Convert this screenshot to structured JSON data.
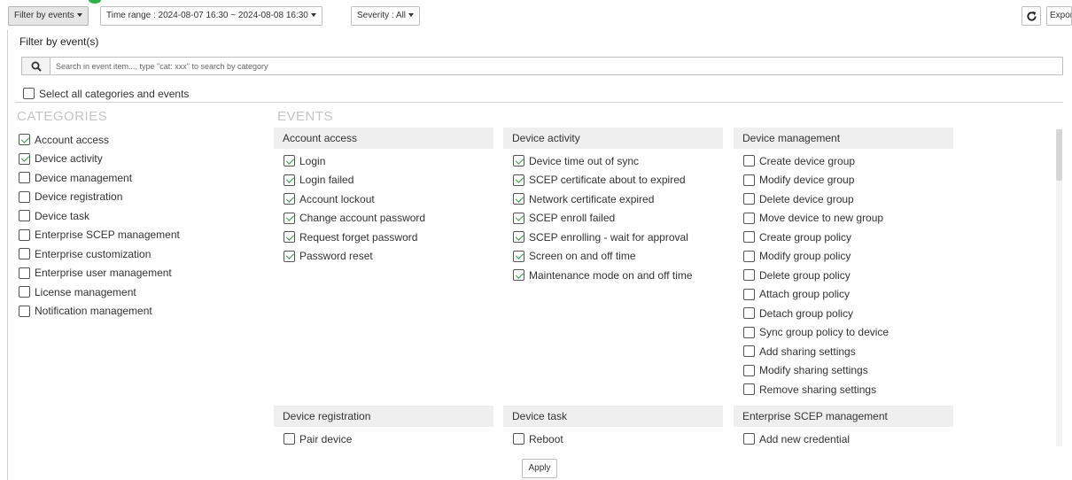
{
  "toolbar": {
    "filter_label": "Filter by events",
    "time_range_label": "Time range : 2024-08-07 16:30 ~ 2024-08-08 16:30",
    "severity_label": "Severity : All",
    "refresh_icon": "refresh-icon",
    "export_label": "Export"
  },
  "panel": {
    "title": "Filter by event(s)",
    "search_placeholder": "Search in event item..., type \"cat: xxx\" to search by category",
    "search_icon": "search-icon",
    "select_all_label": "Select all categories and events",
    "categories_heading": "CATEGORIES",
    "events_heading": "EVENTS"
  },
  "categories": [
    {
      "label": "Account access",
      "checked": true
    },
    {
      "label": "Device activity",
      "checked": true
    },
    {
      "label": "Device management",
      "checked": false
    },
    {
      "label": "Device registration",
      "checked": false
    },
    {
      "label": "Device task",
      "checked": false
    },
    {
      "label": "Enterprise SCEP management",
      "checked": false
    },
    {
      "label": "Enterprise customization",
      "checked": false
    },
    {
      "label": "Enterprise user management",
      "checked": false
    },
    {
      "label": "License management",
      "checked": false
    },
    {
      "label": "Notification management",
      "checked": false
    }
  ],
  "event_groups": [
    {
      "title": "Account access",
      "events": [
        {
          "label": "Login",
          "checked": true
        },
        {
          "label": "Login failed",
          "checked": true
        },
        {
          "label": "Account lockout",
          "checked": true
        },
        {
          "label": "Change account password",
          "checked": true
        },
        {
          "label": "Request forget password",
          "checked": true
        },
        {
          "label": "Password reset",
          "checked": true
        }
      ]
    },
    {
      "title": "Device activity",
      "events": [
        {
          "label": "Device time out of sync",
          "checked": true
        },
        {
          "label": "SCEP certificate about to expired",
          "checked": true
        },
        {
          "label": "Network certificate expired",
          "checked": true
        },
        {
          "label": "SCEP enroll failed",
          "checked": true
        },
        {
          "label": "SCEP enrolling - wait for approval",
          "checked": true
        },
        {
          "label": "Screen on and off time",
          "checked": true
        },
        {
          "label": "Maintenance mode on and off time",
          "checked": true
        }
      ]
    },
    {
      "title": "Device management",
      "events": [
        {
          "label": "Create device group",
          "checked": false
        },
        {
          "label": "Modify device group",
          "checked": false
        },
        {
          "label": "Delete device group",
          "checked": false
        },
        {
          "label": "Move device to new group",
          "checked": false
        },
        {
          "label": "Create group policy",
          "checked": false
        },
        {
          "label": "Modify group policy",
          "checked": false
        },
        {
          "label": "Delete group policy",
          "checked": false
        },
        {
          "label": "Attach group policy",
          "checked": false
        },
        {
          "label": "Detach group policy",
          "checked": false
        },
        {
          "label": "Sync group policy to device",
          "checked": false
        },
        {
          "label": "Add sharing settings",
          "checked": false
        },
        {
          "label": "Modify sharing settings",
          "checked": false
        },
        {
          "label": "Remove sharing settings",
          "checked": false
        }
      ]
    },
    {
      "title": "Device registration",
      "events": [
        {
          "label": "Pair device",
          "checked": false
        }
      ]
    },
    {
      "title": "Device task",
      "events": [
        {
          "label": "Reboot",
          "checked": false
        }
      ]
    },
    {
      "title": "Enterprise SCEP management",
      "events": [
        {
          "label": "Add new credential",
          "checked": false
        }
      ]
    }
  ],
  "apply_label": "Apply"
}
